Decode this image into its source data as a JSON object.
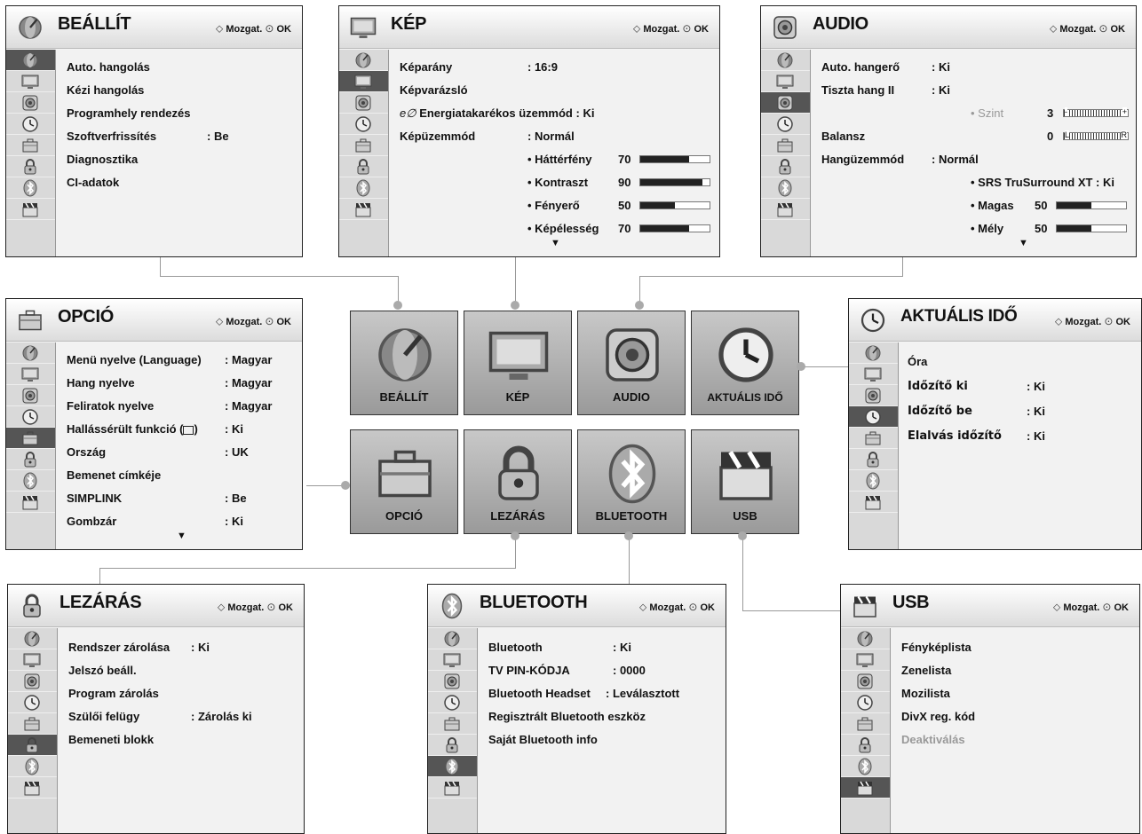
{
  "nav_hint": {
    "arrows": "⬦",
    "move": "Mozgat.",
    "ok_symbol": "⊙",
    "ok": "OK"
  },
  "beallit": {
    "title": "BEÁLLÍT",
    "items": [
      "Auto. hangolás",
      "Kézi hangolás",
      "Programhely rendezés",
      "Szoftverfrissítés",
      "Diagnosztika",
      "CI-adatok"
    ],
    "values": {
      "szoftver": ": Be"
    }
  },
  "kep": {
    "title": "KÉP",
    "r1l": "Képarány",
    "r1v": ": 16:9",
    "r2l": "Képvarázsló",
    "r3l": "Energiatakarékos üzemmód",
    "r3v": ": Ki",
    "r4l": "Képüzemmód",
    "r4v": ": Normál",
    "subs": [
      {
        "l": "• Háttérfény",
        "v": "70"
      },
      {
        "l": "• Kontraszt",
        "v": "90"
      },
      {
        "l": "• Fényerő",
        "v": "50"
      },
      {
        "l": "• Képélesség",
        "v": "70"
      }
    ],
    "more": "▼"
  },
  "audio": {
    "title": "AUDIO",
    "r1l": "Auto. hangerő",
    "r1v": ": Ki",
    "r2l": "Tiszta hang II",
    "r2v": ": Ki",
    "szint_l": "• Szint",
    "szint_v": "3",
    "bal_l": "Balansz",
    "bal_v": "0",
    "hu_l": "Hangüzemmód",
    "hu_v": ": Normál",
    "srs": "• SRS TruSurround XT  : Ki",
    "mag_l": "• Magas",
    "mag_v": "50",
    "mely_l": "• Mély",
    "mely_v": "50",
    "bar_minus": "-",
    "bar_plus": "+",
    "bar_l": "L",
    "bar_r": "R",
    "more": "▼"
  },
  "opcio": {
    "title": "OPCIÓ",
    "rows": [
      {
        "l": "Menü nyelve (Language)",
        "v": ": Magyar"
      },
      {
        "l": "Hang nyelve",
        "v": ": Magyar"
      },
      {
        "l": "Feliratok nyelve",
        "v": ": Magyar"
      },
      {
        "l": "Hallássérült funkció (",
        ":": "",
        "v": ": Ki"
      },
      {
        "l": "Ország",
        "v": ": UK"
      },
      {
        "l": "Bemenet címkéje",
        "v": ""
      },
      {
        "l": "SIMPLINK",
        "v": ": Be"
      },
      {
        "l": "Gombzár",
        "v": ": Ki"
      }
    ],
    "hall_close": ")",
    "more": "▼"
  },
  "ido": {
    "title": "AKTUÁLIS IDŐ",
    "rows": [
      {
        "l": "Óra",
        "v": ""
      },
      {
        "l": "Időzítő ki",
        "v": ": Ki"
      },
      {
        "l": "Időzítő be",
        "v": ": Ki"
      },
      {
        "l": "Elalvás időzítő",
        "v": ": Ki"
      }
    ]
  },
  "lezaras": {
    "title": "LEZÁRÁS",
    "rows": [
      {
        "l": "Rendszer zárolása",
        "v": ": Ki"
      },
      {
        "l": "Jelszó beáll.",
        "v": ""
      },
      {
        "l": "Program zárolás",
        "v": ""
      },
      {
        "l": "Szülői felügy",
        "v": ": Zárolás ki"
      },
      {
        "l": "Bemeneti blokk",
        "v": ""
      }
    ]
  },
  "bluetooth": {
    "title": "BLUETOOTH",
    "rows": [
      {
        "l": "Bluetooth",
        "v": ": Ki"
      },
      {
        "l": "TV PIN-KÓDJA",
        "v": ": 0000"
      },
      {
        "l": "Bluetooth Headset",
        "v": ": Leválasztott"
      },
      {
        "l": "Regisztrált Bluetooth eszköz",
        "v": ""
      },
      {
        "l": "Saját Bluetooth info",
        "v": ""
      }
    ]
  },
  "usb": {
    "title": "USB",
    "rows": [
      "Fényképlista",
      "Zenelista",
      "Mozilista",
      "DivX reg. kód"
    ],
    "disabled": "Deaktiválás"
  },
  "tiles": {
    "beallit": "BEÁLLÍT",
    "kep": "KÉP",
    "audio": "AUDIO",
    "ido": "AKTUÁLIS IDŐ",
    "opcio": "OPCIÓ",
    "lezaras": "LEZÁRÁS",
    "bluetooth": "BLUETOOTH",
    "usb": "USB"
  },
  "levels": {
    "hatterfeny": 0.7,
    "kontraszt": 0.9,
    "fenyero": 0.5,
    "kepelesseg": 0.7,
    "szint": 0.53,
    "balansz": 0.5,
    "magas": 0.5,
    "mely": 0.5
  }
}
